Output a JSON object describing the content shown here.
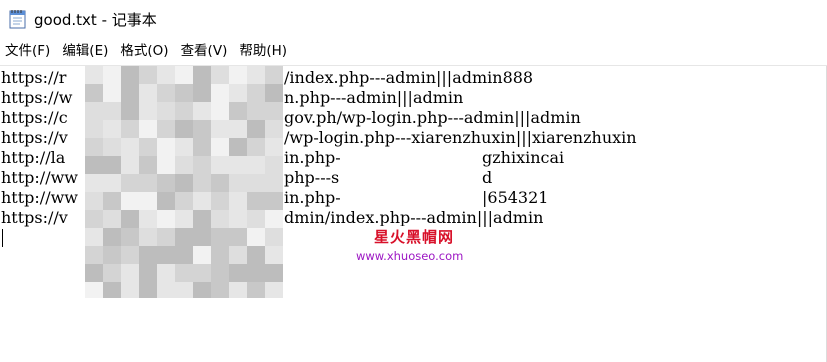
{
  "window": {
    "title": "good.txt - 记事本"
  },
  "menu": [
    "文件(F)",
    "编辑(E)",
    "格式(O)",
    "查看(V)",
    "帮助(H)"
  ],
  "lines": [
    {
      "left": "https://r",
      "right": "/index.php---admin|||admin888"
    },
    {
      "left": "https://w",
      "right": "n.php---admin|||admin"
    },
    {
      "left": "https://c",
      "right": "gov.ph/wp-login.php---admin|||admin"
    },
    {
      "left": "https://v",
      "right": "/wp-login.php---xiarenzhuxin|||xiarenzhuxin"
    },
    {
      "left": "http://la",
      "right": "in.php-",
      "far": "gzhixincai"
    },
    {
      "left": "http://ww",
      "right": "php---s",
      "far": "d"
    },
    {
      "left": "http://ww",
      "right": "in.php-",
      "far": "|654321"
    },
    {
      "left": "https://v",
      "right": "dmin/index.php---admin|||admin"
    }
  ],
  "watermark": {
    "title": "星火黑帽网",
    "url": "www.xhuoseo.com"
  },
  "colors": {
    "watermark_title": "#d8112a",
    "watermark_url": "#9d17c4",
    "mosaic": [
      "#bdbdbd",
      "#d4d4d4",
      "#e6e6e6",
      "#f2f2f2",
      "#c8c8c8",
      "#dedede"
    ]
  },
  "icons": {
    "app": "notepad-icon"
  }
}
